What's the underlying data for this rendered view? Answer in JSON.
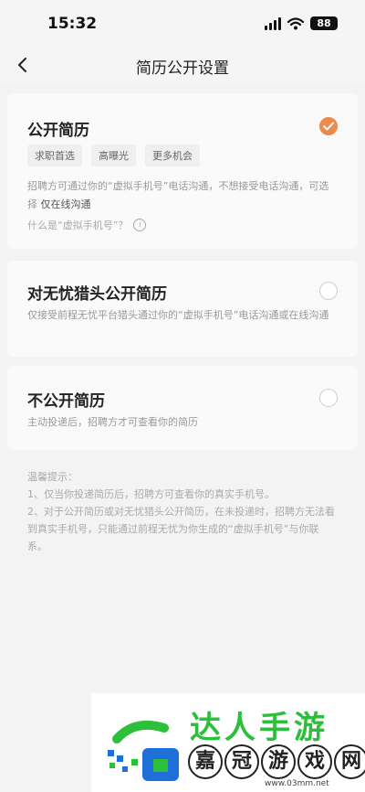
{
  "status": {
    "time": "15:32",
    "battery": "88"
  },
  "nav": {
    "title": "简历公开设置"
  },
  "options": [
    {
      "title": "公开简历",
      "selected": true,
      "tags": [
        "求职首选",
        "高曝光",
        "更多机会"
      ],
      "desc_part1": "招聘方可通过你的“虚拟手机号”电话沟通，不想接受电话沟通，可选择",
      "desc_strong": "仅在线沟通",
      "help": "什么是“虚拟手机号”？"
    },
    {
      "title": "对无忧猎头公开简历",
      "selected": false,
      "desc": "仅接受前程无忧平台猎头通过你的“虚拟手机号”电话沟通或在线沟通"
    },
    {
      "title": "不公开简历",
      "selected": false,
      "desc": "主动投递后，招聘方才可查看你的简历"
    }
  ],
  "tips": {
    "heading": "温馨提示：",
    "items": [
      "1、仅当你投递简历后，招聘方可查看你的真实手机号。",
      "2、对于公开简历或对无忧猎头公开简历，在未投递时，招聘方无法看到真实手机号，只能通过前程无忧为你生成的“虚拟手机号”与你联系。"
    ]
  },
  "watermark": {
    "top": "达人手游",
    "bottom": [
      "嘉",
      "冠",
      "游",
      "戏",
      "网"
    ],
    "url": "www.03mm.net",
    "colors": {
      "green": "#2bbf3a",
      "blue": "#1f6fd8"
    }
  },
  "colors": {
    "accent": "#ef8a4a"
  }
}
